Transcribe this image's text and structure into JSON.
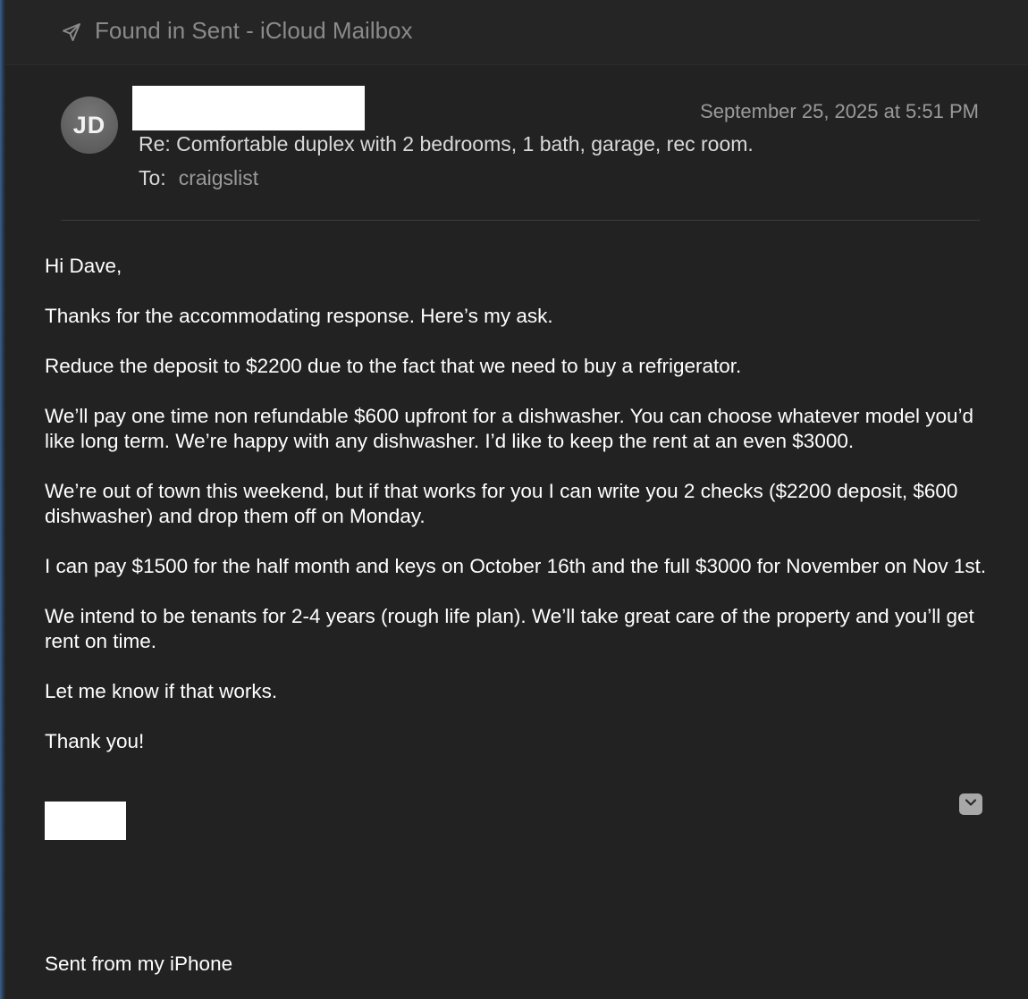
{
  "banner": {
    "icon": "paper-plane-icon",
    "text": "Found in Sent - iCloud Mailbox"
  },
  "header": {
    "avatar_initials": "JD",
    "date": "September 25, 2025 at 5:51 PM",
    "subject": "Re: Comfortable duplex with 2 bedrooms, 1 bath, garage, rec room.",
    "to_label": "To:",
    "to_value": "craigslist"
  },
  "body": {
    "paragraphs": [
      "Hi Dave,",
      "Thanks for the accommodating response. Here’s my ask.",
      "Reduce the deposit to $2200 due to the fact that we need to buy a refrigerator.",
      "We’ll pay one time non refundable $600 upfront for a dishwasher. You can choose whatever model you’d like long term. We’re happy with any dishwasher. I’d like to keep the rent at an even $3000.",
      "We’re out of town this weekend, but if that works for you I can write you 2 checks ($2200 deposit, $600 dishwasher) and drop them off on Monday.",
      "I can pay $1500 for the half month and keys on October 16th and the full $3000 for November on Nov 1st.",
      "We intend to be tenants for 2-4 years (rough life plan). We’ll take great care of the property and you’ll get rent on time.",
      "Let me know if that works.",
      "Thank you!"
    ]
  },
  "footer": {
    "signature": "Sent from my iPhone"
  },
  "colors": {
    "background": "#222222",
    "text": "#ffffff",
    "muted": "#9a9a9a"
  }
}
